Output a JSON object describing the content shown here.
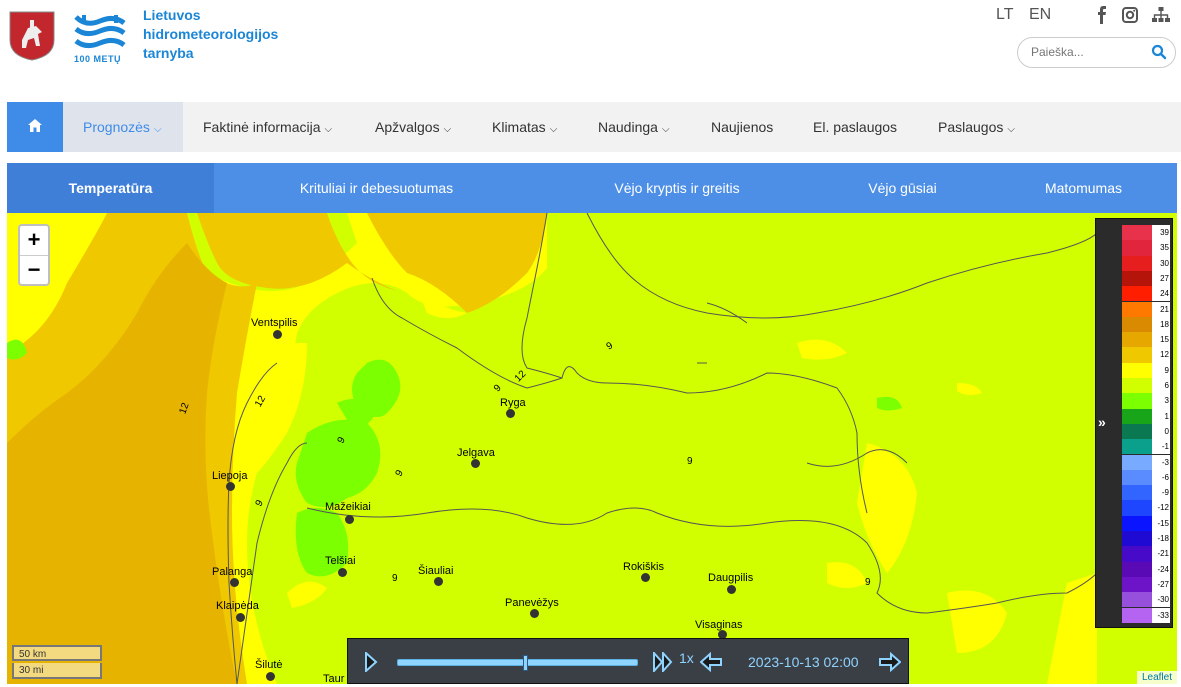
{
  "header": {
    "org_name_line1": "Lietuvos",
    "org_name_line2": "hidrometeorologijos",
    "org_name_line3": "tarnyba",
    "anniversary": "100 METŲ",
    "lang_lt": "LT",
    "lang_en": "EN",
    "search_placeholder": "Paieška..."
  },
  "nav": {
    "items": [
      {
        "label": "Prognozės"
      },
      {
        "label": "Faktinė informacija"
      },
      {
        "label": "Apžvalgos"
      },
      {
        "label": "Klimatas"
      },
      {
        "label": "Naudinga"
      },
      {
        "label": "Naujienos"
      },
      {
        "label": "El. paslaugos"
      },
      {
        "label": "Paslaugos"
      }
    ]
  },
  "subtabs": [
    {
      "label": "Temperatūra"
    },
    {
      "label": "Krituliai ir debesuotumas"
    },
    {
      "label": "Vėjo kryptis ir greitis"
    },
    {
      "label": "Vėjo gūsiai"
    },
    {
      "label": "Matomumas"
    }
  ],
  "map": {
    "zoom_in": "+",
    "zoom_out": "−",
    "scale_km": "50 km",
    "scale_mi": "30 mi",
    "attribution": "Leaflet",
    "cities": [
      {
        "name": "Ventspilis"
      },
      {
        "name": "Ryga"
      },
      {
        "name": "Jelgava"
      },
      {
        "name": "Liepoja"
      },
      {
        "name": "Mažeikiai"
      },
      {
        "name": "Telšiai"
      },
      {
        "name": "Šiauliai"
      },
      {
        "name": "Palanga"
      },
      {
        "name": "Klaipėda"
      },
      {
        "name": "Panevėžys"
      },
      {
        "name": "Rokiškis"
      },
      {
        "name": "Daugpilis"
      },
      {
        "name": "Visaginas"
      },
      {
        "name": "Šilutė"
      },
      {
        "name": "Taur"
      }
    ],
    "contour_labels": [
      "12",
      "12",
      "9",
      "9",
      "9",
      "9",
      "12",
      "9",
      "9",
      "9",
      "9"
    ]
  },
  "player": {
    "speed": "1x",
    "datetime": "2023-10-13 02:00",
    "progress": 0.53
  },
  "legend": {
    "steps": [
      {
        "value": "39",
        "color": "#e8324b"
      },
      {
        "value": "35",
        "color": "#e0253c"
      },
      {
        "value": "30",
        "color": "#e61e1e"
      },
      {
        "value": "27",
        "color": "#b4140a"
      },
      {
        "value": "24",
        "color": "#ff1e00"
      },
      {
        "value": "21",
        "color": "#ff7800"
      },
      {
        "value": "18",
        "color": "#d98a00"
      },
      {
        "value": "15",
        "color": "#e6a800"
      },
      {
        "value": "12",
        "color": "#f0c800"
      },
      {
        "value": "9",
        "color": "#ffff00"
      },
      {
        "value": "6",
        "color": "#d2ff00"
      },
      {
        "value": "3",
        "color": "#7cff00"
      },
      {
        "value": "1",
        "color": "#19a519"
      },
      {
        "value": "0",
        "color": "#0a7850"
      },
      {
        "value": "-1",
        "color": "#0aa08c"
      },
      {
        "value": "-3",
        "color": "#78aaff"
      },
      {
        "value": "-6",
        "color": "#5a8cff"
      },
      {
        "value": "-9",
        "color": "#3264ff"
      },
      {
        "value": "-12",
        "color": "#1e46ff"
      },
      {
        "value": "-15",
        "color": "#0a14ff"
      },
      {
        "value": "-18",
        "color": "#1e0ad2"
      },
      {
        "value": "-21",
        "color": "#460ac8"
      },
      {
        "value": "-24",
        "color": "#5a0ab4"
      },
      {
        "value": "-27",
        "color": "#6e14c8"
      },
      {
        "value": "-30",
        "color": "#9650dc"
      },
      {
        "value": "-33",
        "color": "#b464f0"
      }
    ]
  },
  "colors": {
    "accent": "#3f8be8",
    "subtab_bg": "#4d8fe6",
    "brand": "#1b86d6"
  }
}
